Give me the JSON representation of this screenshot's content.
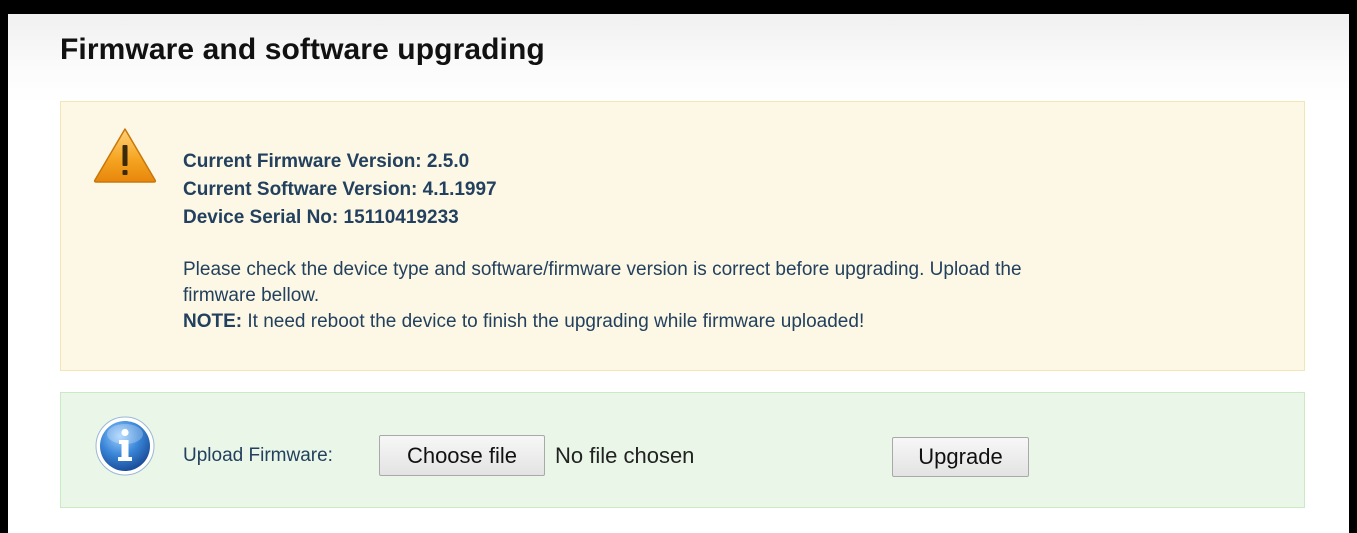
{
  "page": {
    "title": "Firmware and software upgrading"
  },
  "warning": {
    "icon": "warning-triangle-icon",
    "firmware_version": "Current Firmware Version: 2.5.0",
    "software_version": "Current Software Version: 4.1.1997",
    "serial_no": "Device Serial No: 15110419233",
    "instruction_line1": "Please check the device type and software/firmware version is correct before upgrading. Upload the",
    "instruction_line2": "firmware bellow.",
    "note_label": "NOTE:",
    "note_text": " It need reboot the device to finish the upgrading while firmware uploaded!",
    "colors": {
      "background": "#fcf8e5",
      "text": "#23405e"
    }
  },
  "upload": {
    "icon": "info-circle-icon",
    "label": "Upload Firmware:",
    "choose_file_label": "Choose file",
    "file_status": "No file chosen",
    "upgrade_label": "Upgrade",
    "colors": {
      "background": "#eaf7e8"
    }
  }
}
